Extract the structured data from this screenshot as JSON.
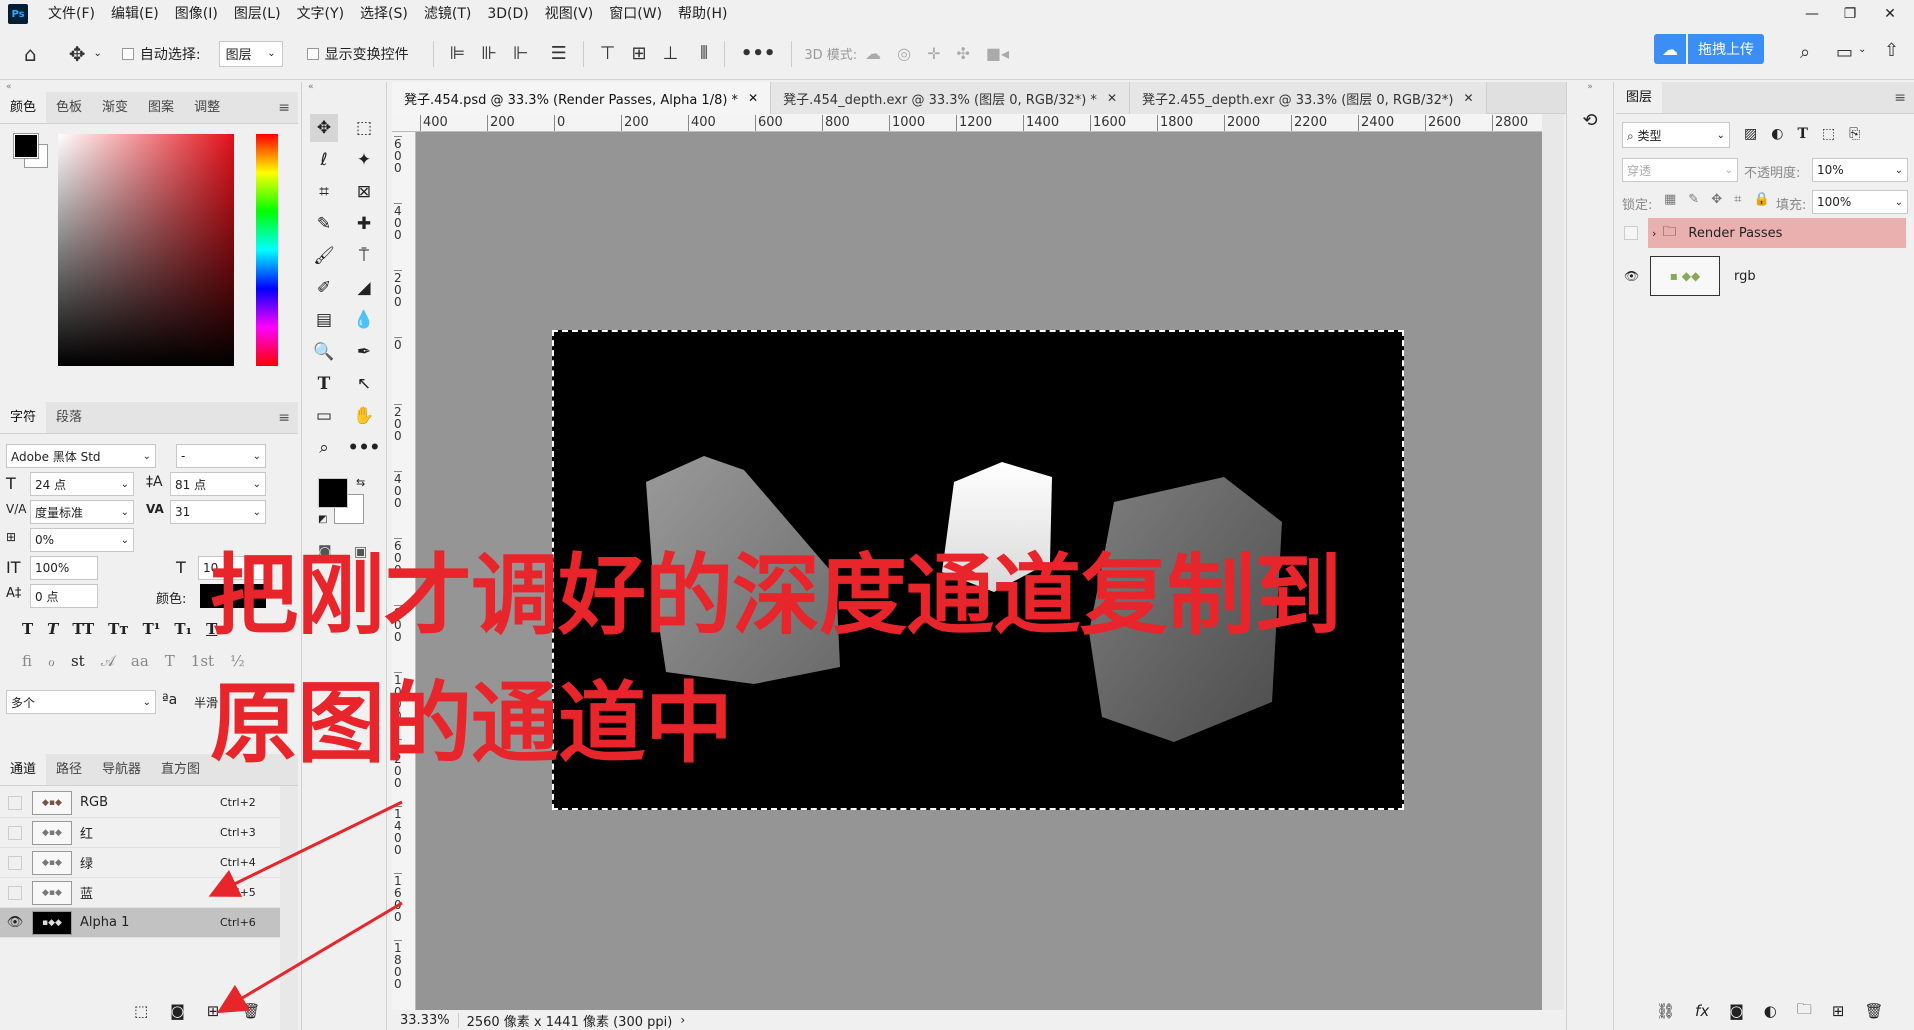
{
  "menu": [
    "文件(F)",
    "编辑(E)",
    "图像(I)",
    "图层(L)",
    "文字(Y)",
    "选择(S)",
    "滤镜(T)",
    "3D(D)",
    "视图(V)",
    "窗口(W)",
    "帮助(H)"
  ],
  "app_logo": "Ps",
  "options": {
    "auto_select_label": "自动选择:",
    "auto_select_value": "图层",
    "show_transform_label": "显示变换控件",
    "mode_3d_label": "3D 模式:",
    "upload_label": "拖拽上传"
  },
  "color_panel": {
    "tabs": [
      "颜色",
      "色板",
      "渐变",
      "图案",
      "调整"
    ]
  },
  "char_panel": {
    "tabs": [
      "字符",
      "段落"
    ],
    "font_family": "Adobe 黑体 Std",
    "font_style": "-",
    "font_size": "24 点",
    "leading": "81 点",
    "kerning": "度量标准",
    "tracking": "31",
    "scale_pct": "0%",
    "vscale": "100%",
    "hscale_partial": "10",
    "baseline": "0 点",
    "color_label": "颜色:",
    "lang": "多个",
    "aa_partial": "半滑"
  },
  "channels_panel": {
    "tabs": [
      "通道",
      "路径",
      "导航器",
      "直方图"
    ],
    "rows": [
      {
        "name": "RGB",
        "shortcut": "Ctrl+2"
      },
      {
        "name": "红",
        "shortcut": "Ctrl+3"
      },
      {
        "name": "绿",
        "shortcut": "Ctrl+4"
      },
      {
        "name": "蓝",
        "shortcut": "Ctrl+5"
      },
      {
        "name": "Alpha 1",
        "shortcut": "Ctrl+6"
      }
    ]
  },
  "doc_tabs": [
    "凳子.454.psd @ 33.3% (Render Passes, Alpha 1/8) *",
    "凳子.454_depth.exr @ 33.3% (图层 0, RGB/32*) *",
    "凳子2.455_depth.exr @ 33.3% (图层 0, RGB/32*)"
  ],
  "ruler_h": [
    "400",
    "200",
    "0",
    "200",
    "400",
    "600",
    "800",
    "1000",
    "1200",
    "1400",
    "1600",
    "1800",
    "2000",
    "2200",
    "2400",
    "2600",
    "2800"
  ],
  "ruler_v": [
    "6\n0\n0",
    "4\n0\n0",
    "2\n0\n0",
    "0",
    "2\n0\n0",
    "4\n0\n0",
    "6\n0\n0",
    "8\n0\n0",
    "1\n0\n0\n0",
    "1\n2\n0\n0",
    "1\n4\n0\n0",
    "1\n6\n0\n0",
    "1\n8\n0\n0"
  ],
  "status": {
    "zoom": "33.33%",
    "size": "2560 像素 x 1441 像素 (300 ppi)"
  },
  "overlay_text": [
    "把刚才调好的深度通道复制到",
    "原图的通道中"
  ],
  "layers_panel": {
    "tab": "图层",
    "filter": "类型",
    "blend": "穿透",
    "opacity_label": "不透明度:",
    "opacity": "10%",
    "lock_label": "锁定:",
    "fill_label": "填充:",
    "fill": "100%",
    "layers": [
      {
        "name": "Render Passes",
        "type": "group"
      },
      {
        "name": "rgb",
        "type": "layer"
      }
    ]
  },
  "colors": {
    "accent_red": "#e8252b",
    "group_highlight": "#eab0b0",
    "canvas_bg": "#959595"
  }
}
